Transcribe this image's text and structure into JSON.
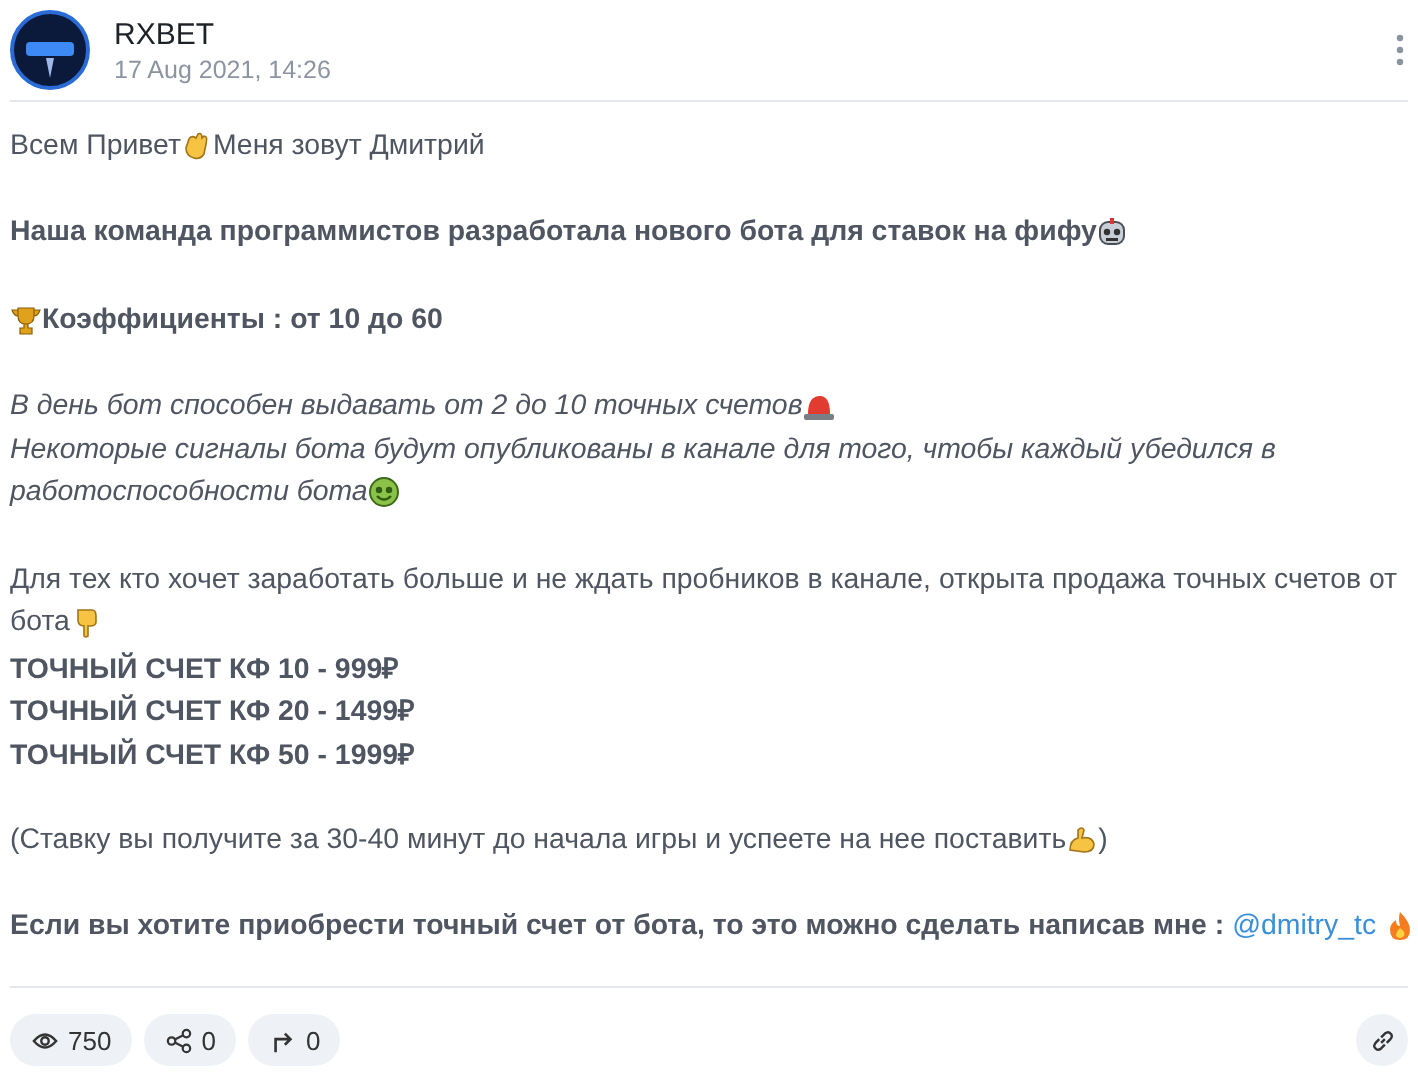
{
  "post": {
    "author": "RXBET",
    "date": "17 Aug 2021, 14:26"
  },
  "paragraphs": [
    [
      {
        "kind": "plain",
        "parts": [
          {
            "kind": "text",
            "text": "Всем Привет"
          },
          {
            "kind": "emoji"
          },
          {
            "kind": "text",
            "text": " Меня зовут Дмитрий"
          }
        ]
      }
    ],
    [
      {
        "kind": "bold",
        "parts": [
          {
            "kind": "text",
            "text": "Наша команда программистов разработала нового бота для ставок на фифу"
          },
          {
            "kind": "emoji"
          }
        ]
      }
    ],
    [
      {
        "kind": "bold",
        "parts": [
          {
            "kind": "emoji"
          },
          {
            "kind": "text",
            "text": "Коэффициенты : от 10 до 60"
          }
        ]
      }
    ],
    [
      {
        "kind": "italic",
        "parts": [
          {
            "kind": "text",
            "text": "В день бот способен выдавать от 2 до 10 точных счетов"
          },
          {
            "kind": "emoji"
          }
        ]
      },
      {
        "kind": "italic",
        "parts": [
          {
            "kind": "text",
            "text": "Некоторые сигналы бота будут опубликованы в канале для того, чтобы каждый убедился в"
          }
        ]
      },
      {
        "kind": "italic",
        "parts": [
          {
            "kind": "text",
            "text": "работоспособности бота"
          },
          {
            "kind": "emoji"
          }
        ]
      }
    ],
    [
      {
        "kind": "plain",
        "parts": [
          {
            "kind": "text",
            "text": "Для тех кто хочет заработать больше и не ждать пробников в канале, открыта продажа точных счетов от"
          }
        ]
      },
      {
        "kind": "plain",
        "parts": [
          {
            "kind": "text",
            "text": "бота"
          },
          {
            "kind": "emoji"
          }
        ]
      },
      {
        "kind": "bold",
        "parts": [
          {
            "kind": "text",
            "text": "ТОЧНЫЙ СЧЕТ КФ 10 - 999₽"
          }
        ]
      },
      {
        "kind": "bold",
        "parts": [
          {
            "kind": "text",
            "text": "ТОЧНЫЙ СЧЕТ КФ 20 - 1499₽"
          }
        ]
      },
      {
        "kind": "bold",
        "parts": [
          {
            "kind": "text",
            "text": "ТОЧНЫЙ СЧЕТ КФ 50 - 1999₽"
          }
        ]
      }
    ],
    [
      {
        "kind": "plain",
        "parts": [
          {
            "kind": "text",
            "text": "(Ставку вы получите за 30-40 минут до начала игры и успеете на нее поставить"
          },
          {
            "kind": "emoji"
          },
          {
            "kind": "text",
            "text": ")"
          }
        ]
      }
    ],
    [
      {
        "kind": "bold",
        "parts": [
          {
            "kind": "text",
            "text": "Если вы хотите приобрести точный счет от бота, то это можно сделать написав мне :"
          },
          {
            "kind": "link",
            "text": "@dmitry_tc"
          },
          {
            "kind": "emoji"
          }
        ]
      }
    ]
  ],
  "footer": {
    "views": "750",
    "shares": "0",
    "forwards": "0"
  }
}
